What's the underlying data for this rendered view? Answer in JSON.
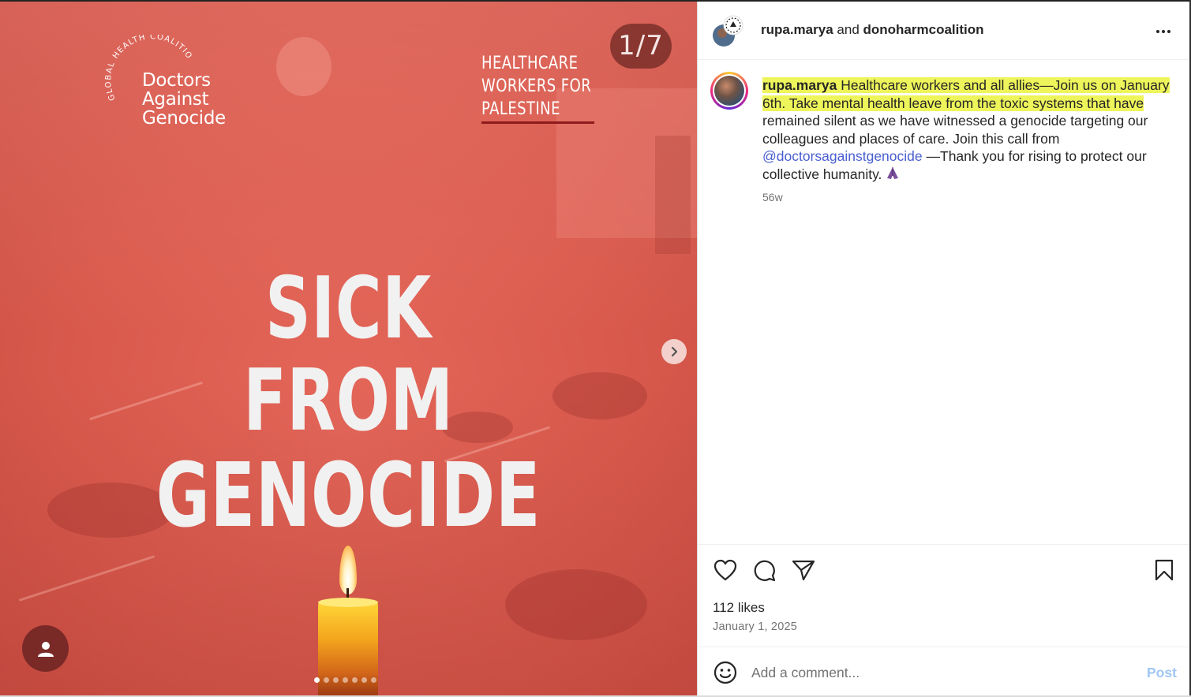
{
  "media": {
    "counter": "1/7",
    "logo": {
      "arc_text": "GLOBAL HEALTH COALITION",
      "line1": "Doctors",
      "line2": "Against",
      "line3": "Genocide"
    },
    "tagline": {
      "line1": "HEALTHCARE",
      "line2": "WORKERS FOR",
      "line3": "PALESTINE"
    },
    "headline": {
      "line1": "SICK",
      "line2": "FROM",
      "line3": "GENOCIDE"
    },
    "slide_count": 7,
    "active_slide": 1,
    "tint_color": "#d95a4d"
  },
  "header": {
    "user1": "rupa.marya",
    "joiner": "and",
    "user2": "donoharmcoalition"
  },
  "caption": {
    "username": "rupa.marya",
    "text_highlighted": "Healthcare workers and all allies—Join us on January 6th. Take mental health leave from the toxic systems that have",
    "text_rest": "remained silent as we have witnessed a genocide targeting our colleagues and places of care. Join this call from",
    "mention": "@doctorsagainstgenocide",
    "text_end": "—Thank you for rising to protect our collective humanity.",
    "emoji": "praying-hands",
    "time_ago": "56w",
    "highlight_color": "#eef55a"
  },
  "actions": {
    "likes": "112 likes",
    "date": "January 1, 2025"
  },
  "comment": {
    "placeholder": "Add a comment...",
    "post_label": "Post"
  }
}
